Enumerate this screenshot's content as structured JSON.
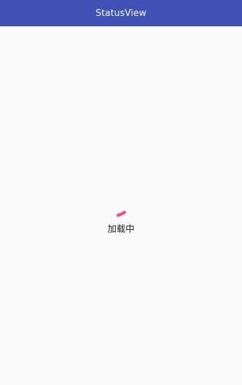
{
  "app_bar": {
    "title": "StatusView",
    "background_color": "#3f51b5"
  },
  "loading": {
    "text": "加载中",
    "indicator_color": "#ff4081",
    "icon": "progress-spinner-icon"
  }
}
